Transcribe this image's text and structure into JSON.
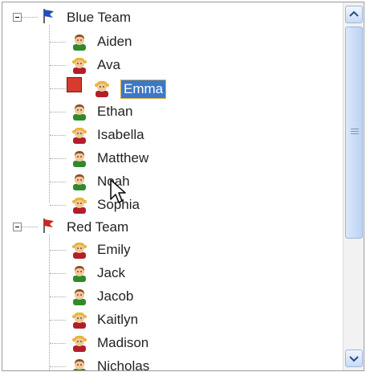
{
  "tree": {
    "groups": [
      {
        "label": "Blue Team",
        "flag_color": "#1f4fb8",
        "members": [
          {
            "label": "Aiden",
            "icon": "boy-icon"
          },
          {
            "label": "Ava",
            "icon": "girl-icon"
          },
          {
            "label": "Emma",
            "icon": "girl-icon",
            "selected": true
          },
          {
            "label": "Ethan",
            "icon": "boy-icon"
          },
          {
            "label": "Isabella",
            "icon": "girl-icon"
          },
          {
            "label": "Matthew",
            "icon": "boy-icon"
          },
          {
            "label": "Noah",
            "icon": "boy-icon"
          },
          {
            "label": "Sophia",
            "icon": "girl-icon"
          }
        ]
      },
      {
        "label": "Red Team",
        "flag_color": "#c8291f",
        "members": [
          {
            "label": "Emily",
            "icon": "girl-icon"
          },
          {
            "label": "Jack",
            "icon": "boy-icon"
          },
          {
            "label": "Jacob",
            "icon": "boy-icon"
          },
          {
            "label": "Kaitlyn",
            "icon": "girl-icon"
          },
          {
            "label": "Madison",
            "icon": "girl-icon"
          },
          {
            "label": "Nicholas",
            "icon": "boy-icon"
          }
        ]
      }
    ]
  },
  "colors": {
    "selection": "#3b78c5",
    "drag_marker": "#d73a2e",
    "boy_shirt": "#2e8a2b",
    "girl_shirt": "#b01f2a",
    "boy_hair": "#8b4a22",
    "girl_hair": "#e7b63a"
  },
  "scrollbar": {
    "thumb_position": 0.0,
    "thumb_fraction": 0.62
  }
}
